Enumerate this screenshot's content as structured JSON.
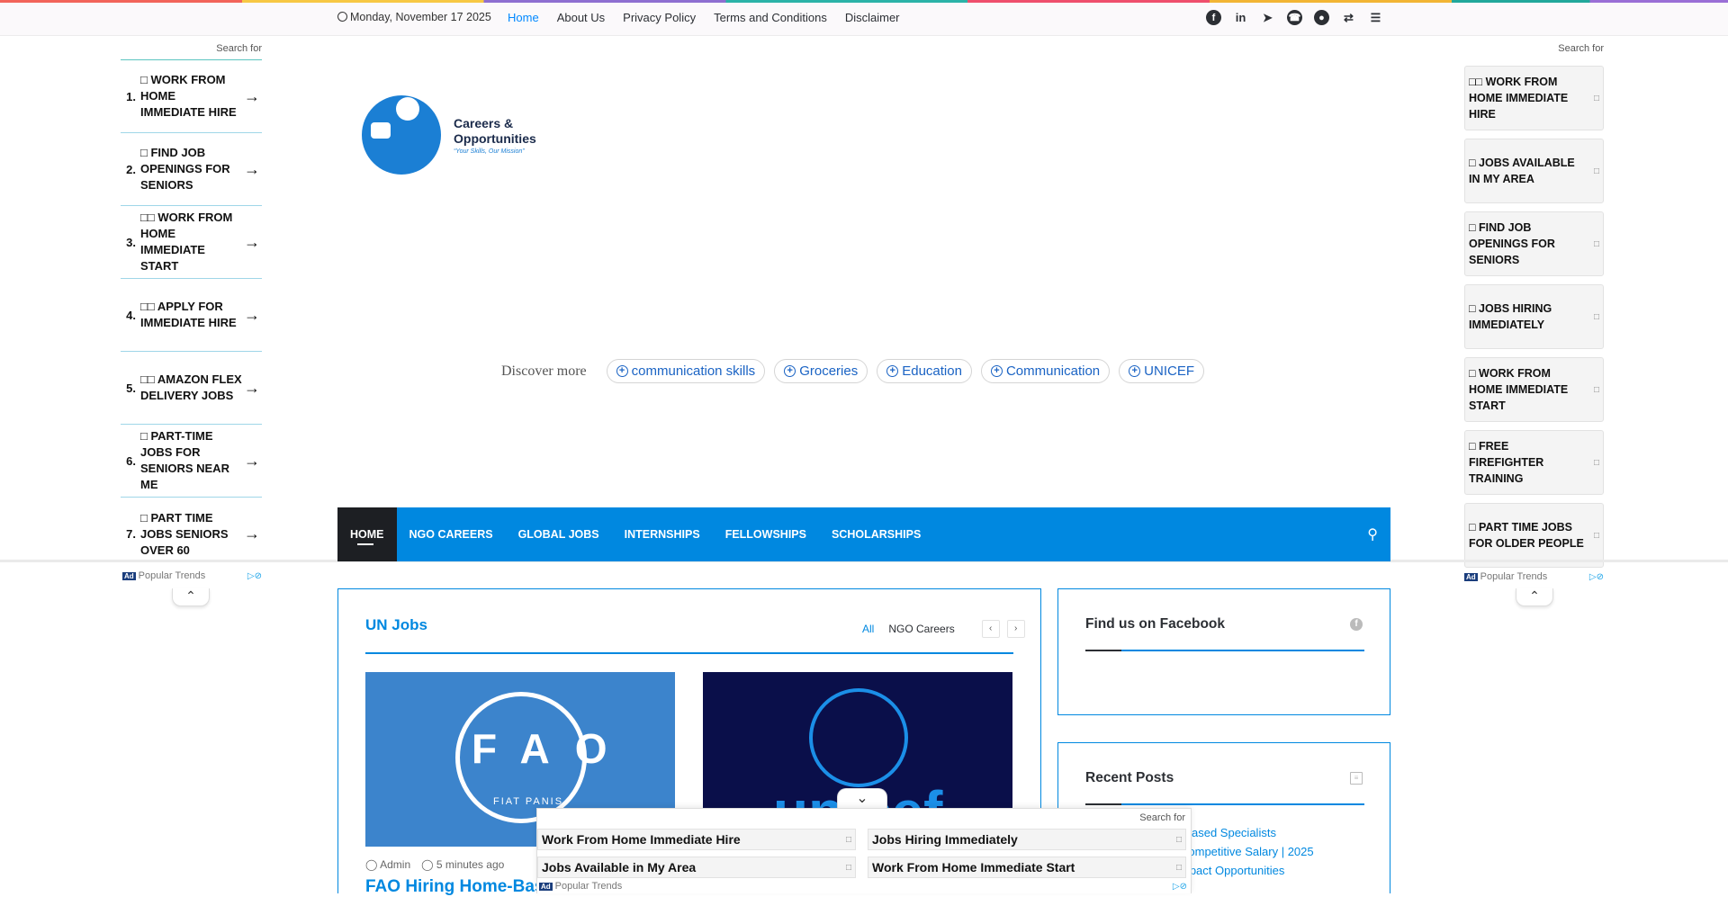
{
  "topbar": {
    "date": "Monday, November 17 2025",
    "nav": [
      "Home",
      "About Us",
      "Privacy Policy",
      "Terms and Conditions",
      "Disclaimer"
    ],
    "active": "Home",
    "social_icons": [
      "facebook-icon",
      "linkedin-icon",
      "telegram-icon",
      "whatsapp-icon",
      "user-icon",
      "shuffle-icon",
      "menu-icon"
    ]
  },
  "left_ad": {
    "search_label": "Search for",
    "items": [
      {
        "num": "1.",
        "label": "□ WORK FROM HOME IMMEDIATE HIRE"
      },
      {
        "num": "2.",
        "label": "□ FIND JOB OPENINGS FOR SENIORS"
      },
      {
        "num": "3.",
        "label": "□□ WORK FROM HOME IMMEDIATE START"
      },
      {
        "num": "4.",
        "label": "□□ APPLY FOR IMMEDIATE HIRE"
      },
      {
        "num": "5.",
        "label": "□□ AMAZON FLEX DELIVERY JOBS"
      },
      {
        "num": "6.",
        "label": "□ PART-TIME JOBS FOR SENIORS NEAR ME"
      },
      {
        "num": "7.",
        "label": "□ PART TIME JOBS SENIORS OVER 60"
      }
    ],
    "footer": "Popular Trends"
  },
  "right_ad": {
    "search_label": "Search for",
    "items": [
      "□□ WORK FROM HOME IMMEDIATE HIRE",
      "□ JOBS AVAILABLE IN MY AREA",
      "□ FIND JOB OPENINGS FOR SENIORS",
      "□ JOBS HIRING IMMEDIATELY",
      "□ WORK FROM HOME IMMEDIATE START",
      "□ FREE FIREFIGHTER TRAINING",
      "□ PART TIME JOBS FOR OLDER PEOPLE"
    ],
    "footer": "Popular Trends"
  },
  "logo": {
    "line1": "Careers &",
    "line2": "Opportunities",
    "tagline": "“Your Skills, Our Mission”"
  },
  "discover": {
    "label": "Discover more",
    "chips": [
      "communication skills",
      "Groceries",
      "Education",
      "Communication",
      "UNICEF"
    ]
  },
  "mainnav": {
    "items": [
      "HOME",
      "NGO CAREERS",
      "GLOBAL JOBS",
      "INTERNSHIPS",
      "FELLOWSHIPS",
      "SCHOLARSHIPS"
    ]
  },
  "un_jobs": {
    "title": "UN Jobs",
    "filter_all": "All",
    "filter_ngo": "NGO Careers",
    "fao_letters": "FAO",
    "fao_motto": "FIAT PANIS",
    "unicef_word": "unicef",
    "author": "Admin",
    "time": "5 minutes ago",
    "post_title": "FAO Hiring Home-Based"
  },
  "facebook_widget": {
    "title": "Find us on Facebook"
  },
  "recent_posts": {
    "title": "Recent Posts",
    "items": [
      "-Based Specialists",
      "Competitive Salary | 2025",
      "mpact Opportunities"
    ]
  },
  "bottom_ad": {
    "search_label": "Search for",
    "items": [
      "Work From Home Immediate Hire",
      "Jobs Hiring Immediately",
      "Jobs Available in My Area",
      "Work From Home Immediate Start"
    ],
    "footer": "Popular Trends"
  },
  "colors": {
    "accent": "#0088e0",
    "dark": "#1d1f23"
  }
}
